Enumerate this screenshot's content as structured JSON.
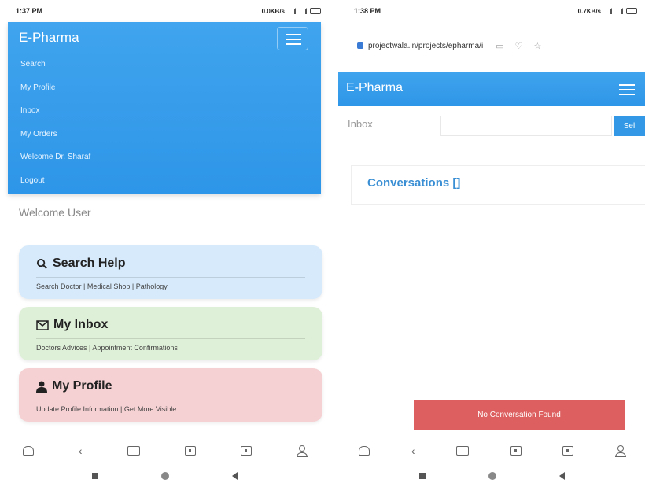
{
  "left": {
    "status": {
      "time": "1:37 PM",
      "network": "0.0KB/s"
    },
    "brand": "E-Pharma",
    "menu": [
      "Search",
      "My Profile",
      "Inbox",
      "My Orders",
      "Welcome Dr. Sharaf",
      "Logout"
    ],
    "welcome": "Welcome User",
    "cards": [
      {
        "icon": "search-icon",
        "title": "Search Help",
        "subtitle": "Search Doctor | Medical Shop | Pathology",
        "color": "#d6eafb"
      },
      {
        "icon": "envelope-icon",
        "title": "My Inbox",
        "subtitle": "Doctors Advices | Appointment Confirmations",
        "color": "#dff0d8"
      },
      {
        "icon": "user-icon",
        "title": "My Profile",
        "subtitle": "Update Profile Information | Get More Visible",
        "color": "#f6d1d3"
      }
    ]
  },
  "right": {
    "status": {
      "time": "1:38 PM",
      "network": "0.7KB/s"
    },
    "url": "projectwala.in/projects/epharma/i",
    "brand": "E-Pharma",
    "inbox_label": "Inbox",
    "search_placeholder": "",
    "search_button": "Sel",
    "conversations_title": "Conversations []",
    "toast": "No Conversation Found"
  },
  "colors": {
    "navbar": "#3399e6",
    "toast": "#dd5f5f",
    "accent_text": "#3a8fd4"
  }
}
